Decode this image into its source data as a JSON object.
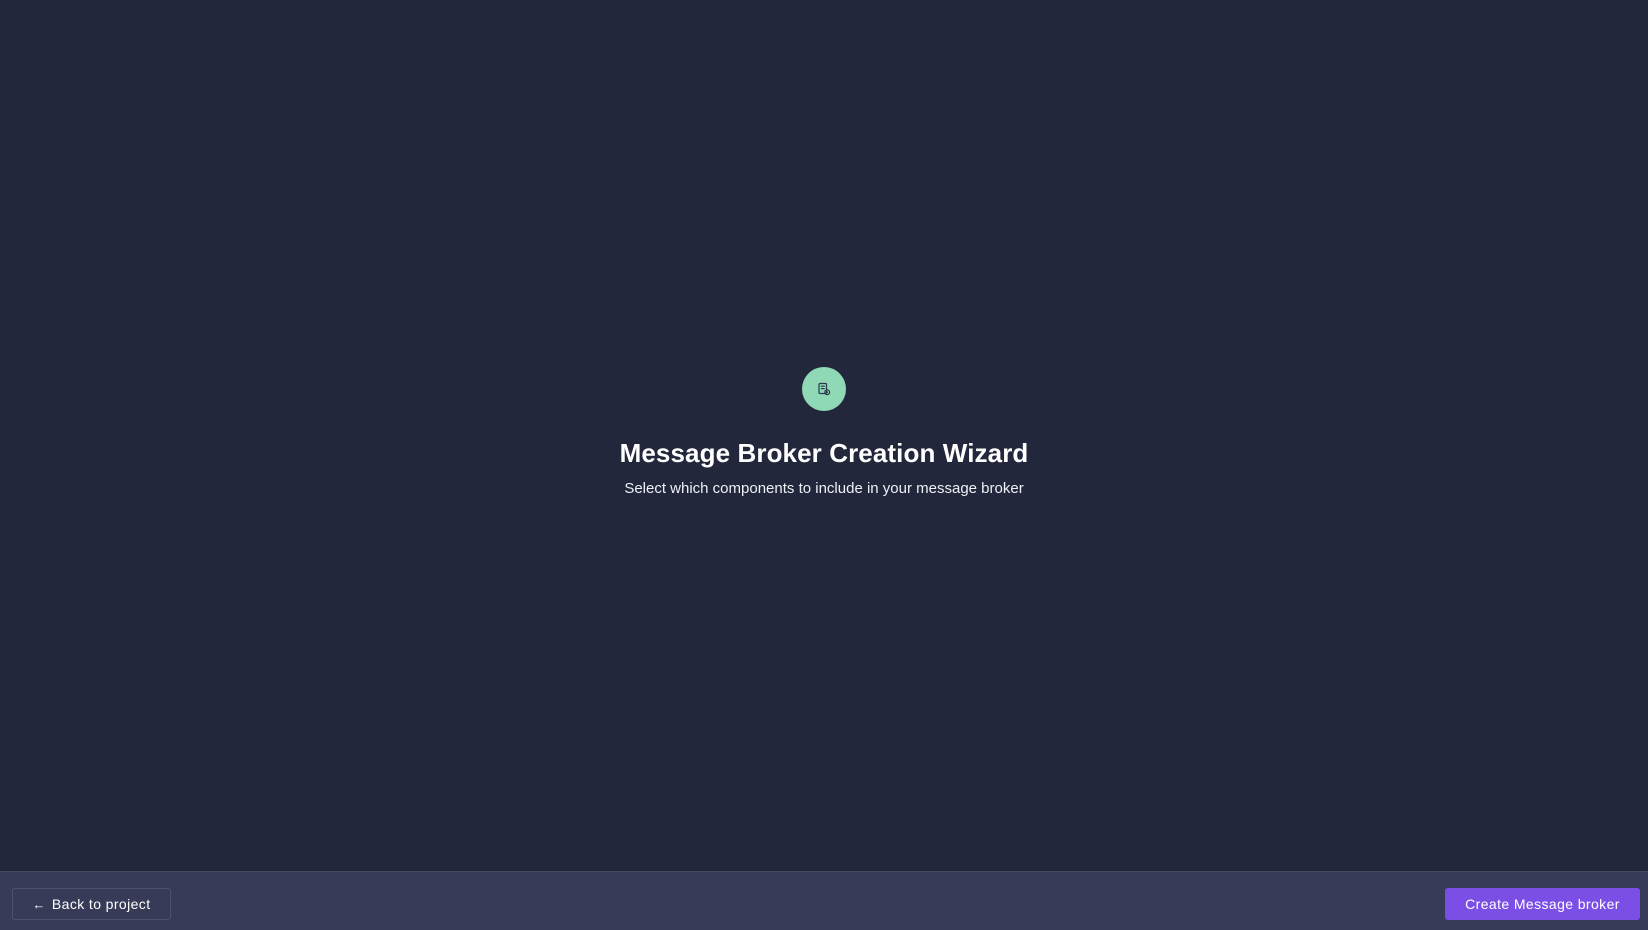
{
  "wizard": {
    "icon": "message-broker-icon",
    "title": "Message Broker Creation Wizard",
    "subtitle": "Select which components to include in your message broker"
  },
  "footer": {
    "back_arrow": "←",
    "back_label": "Back to project",
    "create_label": "Create Message broker"
  },
  "colors": {
    "background": "#22273b",
    "footer_background": "#373b57",
    "icon_circle": "#8fd9b6",
    "icon_stroke": "#2b3a4a",
    "primary_button": "#7b4fe6",
    "text": "#ffffff"
  }
}
